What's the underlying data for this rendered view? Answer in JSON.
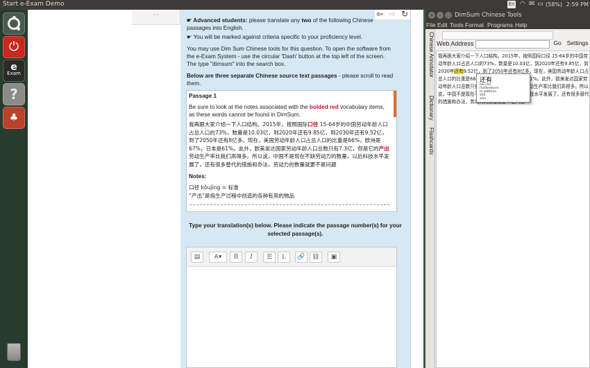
{
  "panel": {
    "app_title": "Start e-Exam Demo",
    "keyboard_lang": "En",
    "battery": "(58%)",
    "clock": "2:59 PM"
  },
  "browser": {
    "tab_corner": ", ,",
    "nav": {
      "back": "⇦",
      "forward": "⇨",
      "reload": "↻"
    },
    "instr": {
      "advanced_lead": "☛ Advanced students:",
      "advanced_text": " please translate any ",
      "two": "two",
      "advanced_tail": " of the following Chinese passages into English.",
      "criteria": "☛ You will be marked against criteria specific to your proficiency level.",
      "dimsum_info": "You may use Dim Sum Chinese tools for this question. To open the software from the e-Exam System - use the circular 'Dash' button at the top left of the screen. The type \"dimsum\" into the search box.",
      "below_bold": "Below are three separate Chinese source text passages",
      "below_tail": " - please scroll to read them."
    },
    "passage": {
      "heading": "Passage 1",
      "note_a": "Be sure to look at the notes associated with the ",
      "note_red": "bolded red",
      "note_b": " vocabulary items, as these words cannot be found in DimSum.",
      "zh_1": "我再跟大家介绍一下人口结构。2015年，按照国际",
      "zh_kj": "口径",
      "zh_2": " 15-64岁的中国劳动年龄人口占总人口的73%，数量是10.03亿，到2020年还有9.85亿，到2030年还有9.52亿，到了2050年还有8亿多。现在，美国劳动年龄人口占总人口的比重是66%，欧洲是67%，日本是61%。此外，欧美发达国家劳动年龄人口总数只有7.3亿，但是它的",
      "zh_cc": "产出",
      "zh_3": "劳动生产率比我们高得多。所以说，中国不是现在不缺劳动力的数量，以后科技水平发展了，还有很多替代的措施和办法，劳动力的数量就更不是问题",
      "notes_heading": "Notes:",
      "note1": "口径 kǒujìng = 标准",
      "note2": "“产出”是指生产过程中创造的各种有用的物品"
    },
    "translation_header": "Type your translation(s) below. Please indicate the passage number(s) for your selected passage(s).",
    "editor_toolbar": {
      "format": "▤",
      "font": "A▾",
      "bold": "B",
      "italic": "I",
      "bullets": "☰",
      "numbers": "⒈",
      "link": "🔗",
      "unlink": "⛓",
      "image": "▣"
    }
  },
  "dimsum": {
    "window_title": "DimSum Chinese Tools",
    "menu": [
      "File",
      "Edit",
      "Tools",
      "Format",
      "Programs",
      "Help"
    ],
    "vertical_tabs": [
      "Chinese Annotator",
      "Dictionary",
      "Flashcards"
    ],
    "address_label": "Web Address",
    "go_label": "Go",
    "settings_label": "Settings",
    "reader_pre": "我再跟大家介绍一下人口结构。2015年，按照国际口径 15-64岁的中国劳动年龄人口占总人口的73%，数量是10.03亿，到2020年还有9.85亿，到2030年",
    "reader_hl": "还有",
    "reader_post": "9.52亿，到了2050年还有8亿多。现在，美国劳动年龄人口占总人口的比重是66%，欧洲是67%，日本是61%。此外，欧美发达国家劳动年龄人口总数只有7.3亿，但是它的产出 劳动生产率比我们高得多。所以说，中国不是现在不缺劳动力的数量，以后科技水平发展了，还有很多替代的措施和办法，劳动力的数量就更不是问题",
    "popup": {
      "headword": "还有",
      "lines": [
        "hái yǒu",
        "furthermore",
        "in addition",
        "still",
        "also"
      ]
    }
  }
}
